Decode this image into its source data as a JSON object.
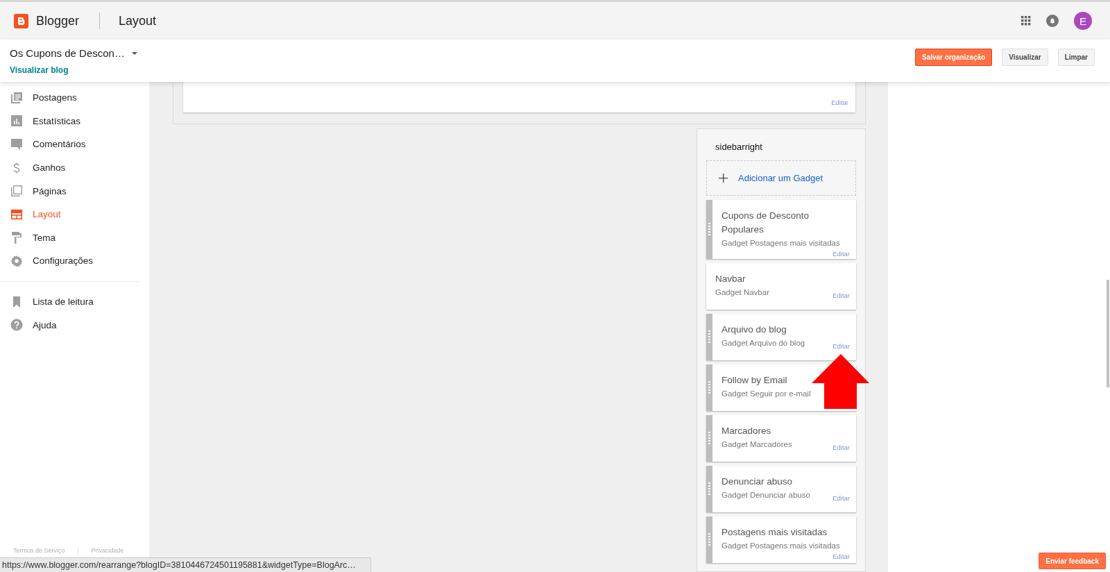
{
  "app": {
    "name": "Blogger",
    "page_title": "Layout",
    "avatar_letter": "E"
  },
  "blog": {
    "title": "Os Cupons de Descon…",
    "view_link": "Visualizar blog"
  },
  "actions": [
    {
      "label": "Salvar organização",
      "kind": "primary"
    },
    {
      "label": "Visualizar",
      "kind": "secondary"
    },
    {
      "label": "Limpar",
      "kind": "secondary"
    }
  ],
  "sidebar": {
    "items": [
      {
        "label": "Postagens",
        "kind": "posts",
        "selected": false
      },
      {
        "label": "Estatísticas",
        "kind": "stats",
        "selected": false
      },
      {
        "label": "Comentários",
        "kind": "comments",
        "selected": false
      },
      {
        "label": "Ganhos",
        "kind": "earnings",
        "selected": false
      },
      {
        "label": "Páginas",
        "kind": "pages",
        "selected": false
      },
      {
        "label": "Layout",
        "kind": "layout",
        "selected": true
      },
      {
        "label": "Tema",
        "kind": "theme",
        "selected": false
      },
      {
        "label": "Configurações",
        "kind": "settings",
        "selected": false
      }
    ],
    "secondary_items": [
      {
        "label": "Lista de leitura",
        "kind": "bookmark",
        "selected": false
      },
      {
        "label": "Ajuda",
        "kind": "help",
        "selected": false
      }
    ],
    "footer_links": [
      "Termos de Serviço",
      "Privacidade"
    ]
  },
  "top_section": {
    "edit_link": "Editar"
  },
  "sidebarright": {
    "title": "sidebarright",
    "add_gadget": "Adicionar um Gadget",
    "gadgets": [
      {
        "title": "Cupons de Desconto Populares",
        "subtitle": "Gadget Postagens mais visitadas",
        "edit_link": "Editar",
        "draggable": true
      },
      {
        "title": "Navbar",
        "subtitle": "Gadget Navbar",
        "edit_link": "Editar",
        "draggable": false
      },
      {
        "title": "Arquivo do blog",
        "subtitle": "Gadget Arquivo do blog",
        "edit_link": "Editar",
        "draggable": true
      },
      {
        "title": "Follow by Email",
        "subtitle": "Gadget Seguir por e-mail",
        "draggable": true
      },
      {
        "title": "Marcadores",
        "subtitle": "Gadget Marcadores",
        "edit_link": "Editar",
        "draggable": true
      },
      {
        "title": "Denunciar abuso",
        "subtitle": "Gadget Denunciar abuso",
        "edit_link": "Editar",
        "draggable": true
      },
      {
        "title": "Postagens mais visitadas",
        "subtitle": "Gadget Postagens mais visitadas",
        "edit_link": "Editar",
        "draggable": true
      }
    ]
  },
  "status_url": "https://www.blogger.com/rearrange?blogID=3810446724501195881&widgetType=BlogArc…",
  "feedback_button": "Enviar feedback"
}
